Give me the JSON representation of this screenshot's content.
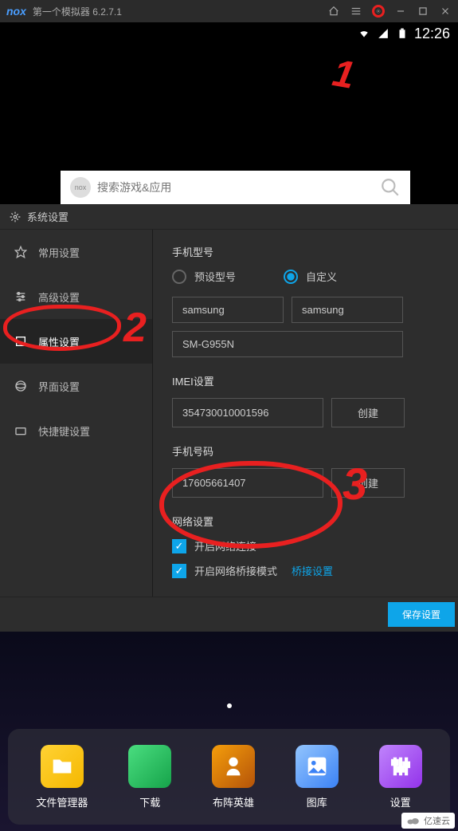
{
  "titlebar": {
    "logo": "nox",
    "title": "第一个模拟器 6.2.7.1"
  },
  "statusbar": {
    "time": "12:26"
  },
  "search": {
    "logo": "nox",
    "placeholder": "搜索游戏&应用"
  },
  "settings": {
    "title": "系统设置",
    "sidebar": [
      {
        "label": "常用设置"
      },
      {
        "label": "高级设置"
      },
      {
        "label": "属性设置"
      },
      {
        "label": "界面设置"
      },
      {
        "label": "快捷键设置"
      }
    ],
    "content": {
      "phone_model_label": "手机型号",
      "radio_preset": "预设型号",
      "radio_custom": "自定义",
      "brand1": "samsung",
      "brand2": "samsung",
      "model": "SM-G955N",
      "imei_label": "IMEI设置",
      "imei_value": "354730010001596",
      "create_btn": "创建",
      "phone_number_label": "手机号码",
      "phone_number_value": "17605661407",
      "network_label": "网络设置",
      "network_enable": "开启网络连接",
      "bridge_enable": "开启网络桥接模式",
      "bridge_link": "桥接设置"
    },
    "save_btn": "保存设置"
  },
  "dock": [
    {
      "label": "文件管理器"
    },
    {
      "label": "下载"
    },
    {
      "label": "布阵英雄"
    },
    {
      "label": "图库"
    },
    {
      "label": "设置"
    }
  ],
  "annotations": {
    "one": "1",
    "two": "2",
    "three": "3"
  },
  "watermark": "亿速云"
}
